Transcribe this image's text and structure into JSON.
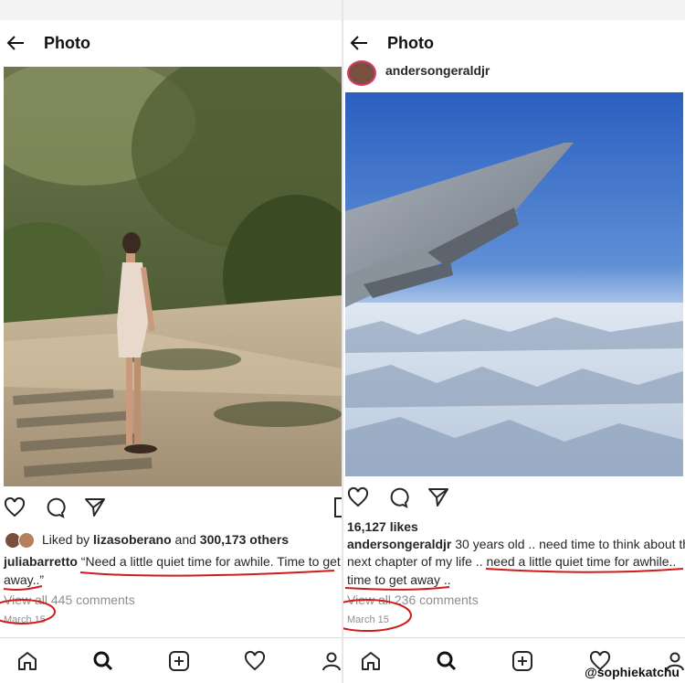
{
  "left": {
    "header": {
      "title": "Photo"
    },
    "likes": {
      "prefix": "Liked by ",
      "user": "lizasoberano",
      "middle": " and ",
      "count": "300,173 others"
    },
    "caption": {
      "username": "juliabarretto",
      "line1": " “Need a little quiet time for awhile. Time to get",
      "line2": "away..”"
    },
    "comments_link": "View all 445 comments",
    "date": "March 15"
  },
  "right": {
    "header": {
      "title": "Photo"
    },
    "post_username": "andersongeraldjr",
    "likes": "16,127 likes",
    "caption": {
      "username": "andersongeraldjr",
      "line1": " 30 years old .. need time to think about th",
      "line2": "next chapter of my life .. need a little quiet time for awhile..",
      "line3": "time to get away .."
    },
    "comments_link": "View all 236 comments",
    "date": "March 15"
  },
  "nav": {
    "items": [
      "home-icon",
      "search-icon",
      "new-post-icon",
      "activity-icon",
      "profile-icon"
    ]
  },
  "watermark": "@sophiekatchu",
  "colors": {
    "annotation": "#d01c1c",
    "text": "#262626",
    "muted": "#8e8e8e",
    "sky": "#2e66c4"
  }
}
